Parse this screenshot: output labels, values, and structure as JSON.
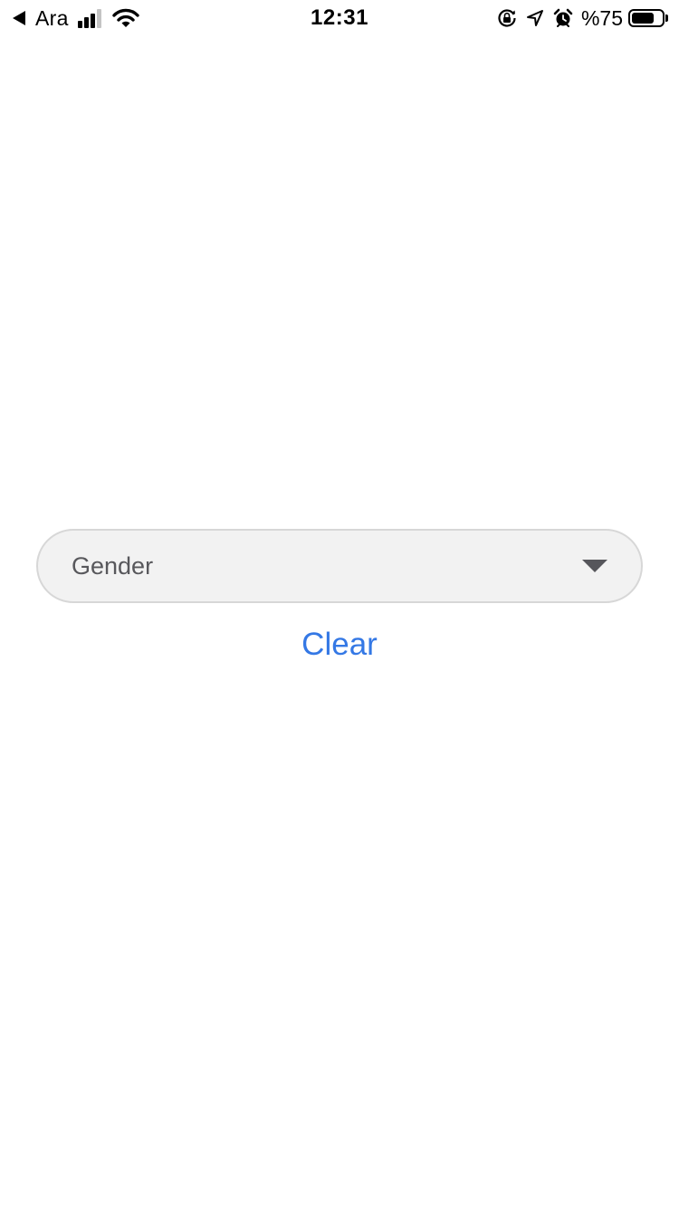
{
  "status_bar": {
    "carrier": "Ara",
    "time": "12:31",
    "battery_text": "%75",
    "battery_level": 0.75,
    "icons": [
      "back-arrow-icon",
      "signal-icon",
      "wifi-icon",
      "orientation-lock-icon",
      "location-arrow-icon",
      "alarm-icon",
      "battery-icon"
    ]
  },
  "form": {
    "gender_select": {
      "placeholder": "Gender",
      "icon": "chevron-down-icon"
    },
    "clear_label": "Clear"
  },
  "colors": {
    "accent": "#3478e5",
    "select_background": "#f2f2f2",
    "select_border": "#d7d7d7",
    "select_text": "#58585c"
  }
}
